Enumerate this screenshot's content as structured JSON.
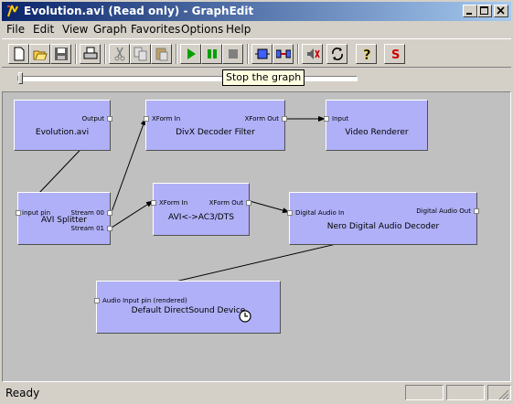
{
  "window": {
    "title": "Evolution.avi (Read only) - GraphEdit"
  },
  "menu": [
    "File",
    "Edit",
    "View",
    "Graph",
    "Favorites",
    "Options",
    "Help"
  ],
  "tooltip": "Stop the graph",
  "toolbar": {
    "buttons": [
      "new-icon",
      "open-icon",
      "save-icon",
      "print-icon",
      "cut-icon",
      "copy-icon",
      "paste-icon",
      "play-icon",
      "pause-icon",
      "stop-icon",
      "seek-icon",
      "connect-icon",
      "mute-icon",
      "refresh-icon",
      "help-icon",
      "stop-s-icon"
    ]
  },
  "filters": {
    "source": {
      "name": "Evolution.avi",
      "output": "Output"
    },
    "divx": {
      "name": "DivX Decoder Filter",
      "input": "XForm In",
      "output": "XForm Out"
    },
    "video": {
      "name": "Video Renderer",
      "input": "Input"
    },
    "splitter": {
      "name": "AVI Splitter",
      "input": "input pin",
      "output0": "Stream 00",
      "output1": "Stream 01"
    },
    "ac3": {
      "name": "AVI<->AC3/DTS",
      "input": "XForm In",
      "output": "XForm Out"
    },
    "nero": {
      "name": "Nero Digital Audio Decoder",
      "input": "Digital Audio In",
      "output": "Digital Audio Out"
    },
    "dsound": {
      "name": "Default DirectSound Device",
      "input": "Audio Input pin (rendered)"
    }
  },
  "status": {
    "text": "Ready"
  }
}
